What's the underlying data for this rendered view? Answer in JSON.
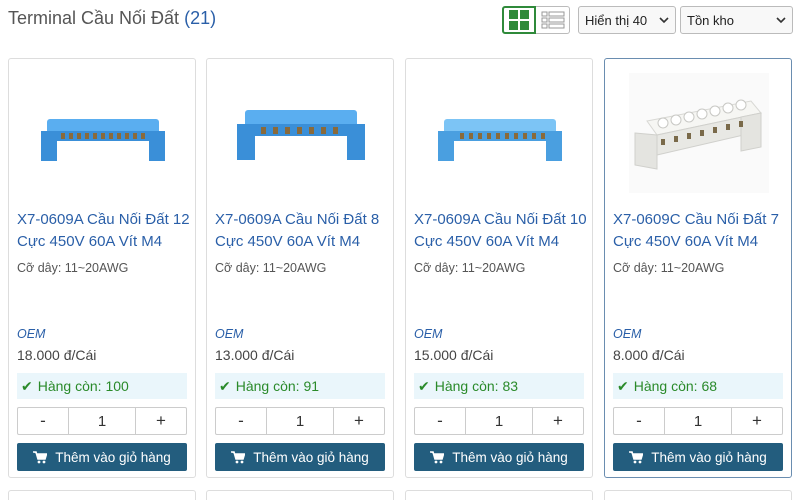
{
  "header": {
    "title": "Terminal Cầu Nối Đất",
    "count": "(21)"
  },
  "toolbar": {
    "display_select": "Hiển thị 40",
    "stock_select": "Tồn kho"
  },
  "products": [
    {
      "name": "X7-0609A Cầu Nối Đất 12 Cực 450V 60A Vít M4",
      "spec": "Cỡ dây: 11~20AWG",
      "brand": "OEM",
      "price": "18.000 đ/Cái",
      "stock": "Hàng còn: 100",
      "qty": "1",
      "minus": "-",
      "plus": "+",
      "add_label": "Thêm vào giỏ hàng",
      "colors": {
        "body": "#3a8fd8",
        "top": "#5aaef0"
      }
    },
    {
      "name": "X7-0609A Cầu Nối Đất 8 Cực 450V 60A Vít M4",
      "spec": "Cỡ dây: 11~20AWG",
      "brand": "OEM",
      "price": "13.000 đ/Cái",
      "stock": "Hàng còn: 91",
      "qty": "1",
      "minus": "-",
      "plus": "+",
      "add_label": "Thêm vào giỏ hàng",
      "colors": {
        "body": "#3a8fd8",
        "top": "#5aaef0"
      }
    },
    {
      "name": "X7-0609A Cầu Nối Đất 10 Cực 450V 60A Vít M4",
      "spec": "Cỡ dây: 11~20AWG",
      "brand": "OEM",
      "price": "15.000 đ/Cái",
      "stock": "Hàng còn: 83",
      "qty": "1",
      "minus": "-",
      "plus": "+",
      "add_label": "Thêm vào giỏ hàng",
      "colors": {
        "body": "#4a9fe0",
        "top": "#7cc4f5"
      }
    },
    {
      "name": "X7-0609C Cầu Nối Đất 7 Cực 450V 60A Vít M4",
      "spec": "Cỡ dây: 11~20AWG",
      "brand": "OEM",
      "price": "8.000 đ/Cái",
      "stock": "Hàng còn: 68",
      "qty": "1",
      "minus": "-",
      "plus": "+",
      "add_label": "Thêm vào giỏ hàng",
      "colors": {
        "body": "#e8e8e4",
        "top": "#f6f6f3"
      }
    }
  ]
}
